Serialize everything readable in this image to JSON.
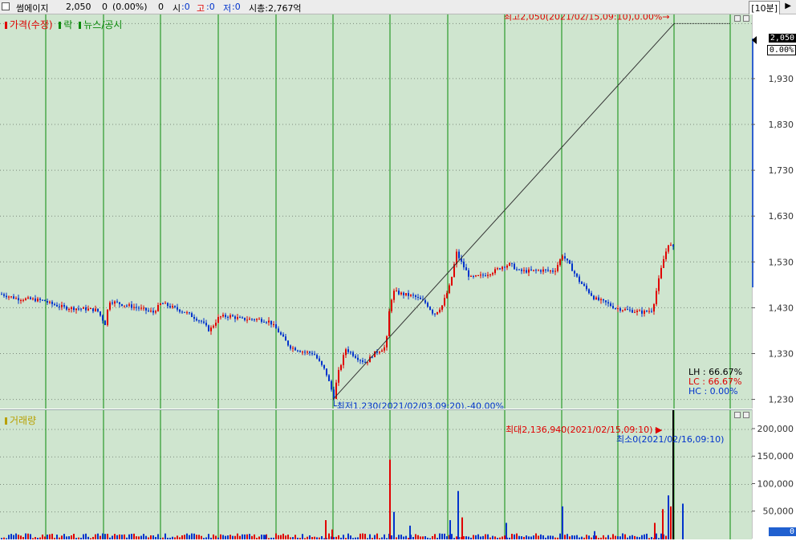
{
  "header": {
    "stock_name": "썸에이지",
    "price": "2,050",
    "change": "0",
    "change_pct": "(0.00%)",
    "volume": "0",
    "open_label": "시",
    "open_value": ":0",
    "high_label": "고",
    "high_value": ":0",
    "low_label": "저",
    "low_value": ":0",
    "mcap": "시총:2,767억",
    "period": "[10분]"
  },
  "legend": {
    "price_label": "가격(수정)",
    "drop_label": "락",
    "news_label": "뉴스/공시",
    "volume_label": "거래량"
  },
  "price_axis": {
    "current_price_tag": "2,050",
    "current_pct_tag": "0.00%",
    "ticks": [
      "1,930",
      "1,830",
      "1,730",
      "1,630",
      "1,530",
      "1,430",
      "1,330",
      "1,230"
    ]
  },
  "volume_axis": {
    "ticks": [
      "200,000",
      "150,000",
      "100,000",
      "50,000"
    ],
    "current_tag": "0"
  },
  "annotations": {
    "high_label": "최고2,050(2021/02/15,09:10),0.00%",
    "low_label": "최저1,230(2021/02/03,09:20),-40.00%",
    "vol_max_label": "최대2,136,940(2021/02/15,09:10)",
    "vol_min_label": "최소0(2021/02/16,09:10)"
  },
  "stats": {
    "lh": "LH : 66.67%",
    "lc": "LC : 66.67%",
    "hc": "HC :  0.00%"
  },
  "colors": {
    "panel_bg": "#cfe5cf",
    "up": "#e00000",
    "down": "#0033cc",
    "day_sep": "#0a8a0a",
    "grid": "#7c8a7c"
  },
  "chart_data": {
    "type": "candlestick",
    "ylim": [
      1210,
      2070
    ],
    "vol_ylim": [
      0,
      235000
    ],
    "trend_line": {
      "from": [
        1230
      ],
      "to": [
        2050
      ]
    },
    "close_path": [
      [
        0,
        1460
      ],
      [
        20,
        1450
      ],
      [
        40,
        1448
      ],
      [
        55,
        1445
      ],
      [
        60,
        1440
      ],
      [
        80,
        1430
      ],
      [
        100,
        1428
      ],
      [
        120,
        1425
      ],
      [
        130,
        1395
      ],
      [
        135,
        1445
      ],
      [
        150,
        1438
      ],
      [
        170,
        1430
      ],
      [
        190,
        1420
      ],
      [
        200,
        1440
      ],
      [
        215,
        1430
      ],
      [
        230,
        1420
      ],
      [
        250,
        1400
      ],
      [
        260,
        1380
      ],
      [
        272,
        1410
      ],
      [
        285,
        1412
      ],
      [
        300,
        1405
      ],
      [
        320,
        1405
      ],
      [
        335,
        1400
      ],
      [
        345,
        1380
      ],
      [
        360,
        1345
      ],
      [
        375,
        1335
      ],
      [
        390,
        1330
      ],
      [
        405,
        1290
      ],
      [
        415,
        1235
      ],
      [
        420,
        1285
      ],
      [
        430,
        1340
      ],
      [
        445,
        1320
      ],
      [
        455,
        1310
      ],
      [
        465,
        1330
      ],
      [
        480,
        1345
      ],
      [
        485,
        1440
      ],
      [
        490,
        1465
      ],
      [
        500,
        1460
      ],
      [
        515,
        1455
      ],
      [
        530,
        1440
      ],
      [
        540,
        1415
      ],
      [
        550,
        1435
      ],
      [
        560,
        1480
      ],
      [
        568,
        1550
      ],
      [
        575,
        1525
      ],
      [
        585,
        1495
      ],
      [
        600,
        1500
      ],
      [
        615,
        1510
      ],
      [
        625,
        1520
      ],
      [
        635,
        1525
      ],
      [
        645,
        1510
      ],
      [
        660,
        1510
      ],
      [
        675,
        1512
      ],
      [
        690,
        1510
      ],
      [
        700,
        1545
      ],
      [
        710,
        1520
      ],
      [
        720,
        1490
      ],
      [
        730,
        1470
      ],
      [
        740,
        1450
      ],
      [
        755,
        1440
      ],
      [
        765,
        1430
      ],
      [
        780,
        1425
      ],
      [
        800,
        1420
      ],
      [
        812,
        1425
      ],
      [
        818,
        1475
      ],
      [
        825,
        1530
      ],
      [
        832,
        1570
      ],
      [
        838,
        1560
      ]
    ],
    "volume_spikes": [
      [
        130,
        10000
      ],
      [
        330,
        8000
      ],
      [
        405,
        35000
      ],
      [
        413,
        18000
      ],
      [
        485,
        145000
      ],
      [
        490,
        50000
      ],
      [
        510,
        25000
      ],
      [
        560,
        35000
      ],
      [
        570,
        88000
      ],
      [
        575,
        40000
      ],
      [
        630,
        30000
      ],
      [
        700,
        60000
      ],
      [
        740,
        15000
      ],
      [
        815,
        30000
      ],
      [
        825,
        55000
      ],
      [
        832,
        80000
      ],
      [
        835,
        60000
      ],
      [
        838,
        2136940
      ],
      [
        850,
        65000
      ]
    ],
    "day_separators_x": [
      57,
      129,
      200,
      272,
      344,
      415,
      486,
      558,
      629,
      700,
      770,
      840
    ]
  }
}
